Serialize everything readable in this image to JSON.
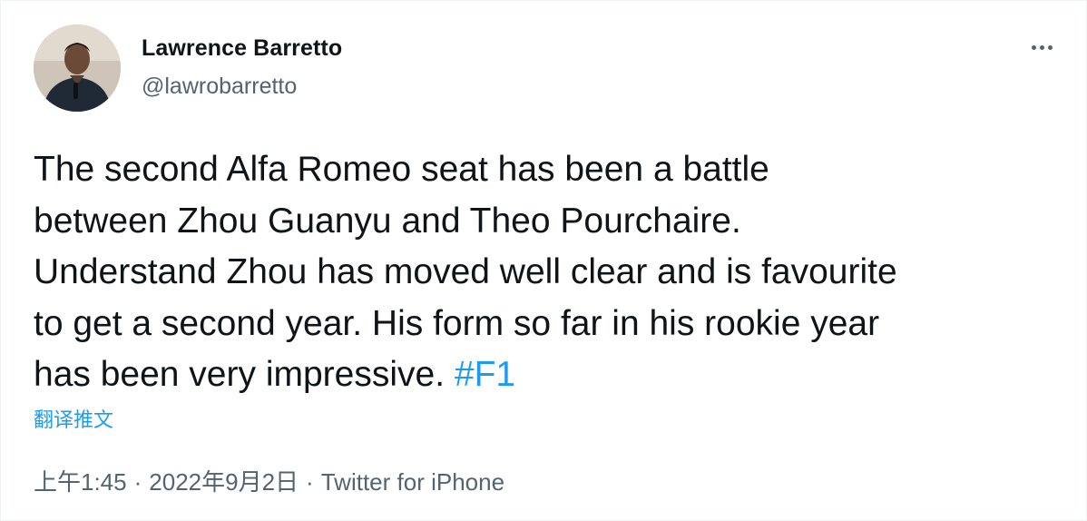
{
  "author": {
    "name": "Lawrence Barretto",
    "handle": "@lawrobarretto",
    "avatar_icon": "profile-photo"
  },
  "tweet": {
    "text": "The second Alfa Romeo seat has been a battle\nbetween Zhou Guanyu and Theo Pourchaire.\nUnderstand Zhou has moved well clear and is favourite\nto get a second year. His form so far in his rookie year\nhas been very impressive. ",
    "hashtag": "#F1",
    "translate_label": "翻译推文"
  },
  "meta": {
    "time": "上午1:45",
    "date": "2022年9月2日",
    "separator": "·",
    "source": "Twitter for iPhone"
  },
  "icons": {
    "more": "more-horizontal-icon"
  },
  "colors": {
    "link": "#1d9bf0",
    "secondary_text": "#536471",
    "primary_text": "#0f1419"
  }
}
